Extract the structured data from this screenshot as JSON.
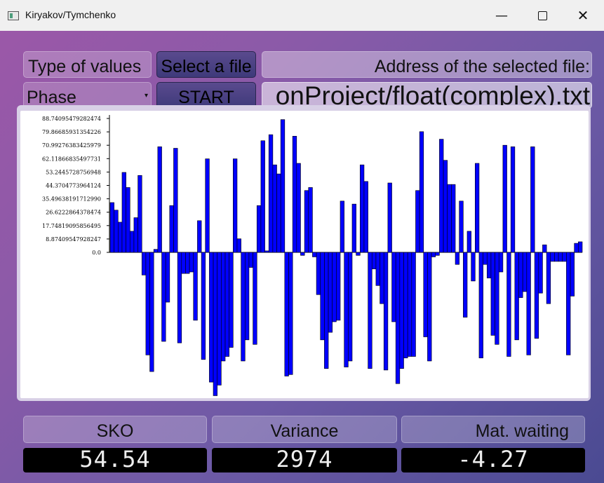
{
  "window": {
    "title": "Kiryakov/Tymchenko",
    "controls": {
      "minimize": "—",
      "close": "✕"
    }
  },
  "controls": {
    "type_of_values_label": "Type of values",
    "select_file_button": "Select a file",
    "address_label": "Address of the selected file:",
    "type_select_value": "Phase",
    "start_button": "START",
    "file_path_value": "onProject/float(complex).txt"
  },
  "stats": {
    "sko_label": "SKO",
    "variance_label": "Variance",
    "mat_waiting_label": "Mat. waiting",
    "sko_value": "54.54",
    "variance_value": "2974",
    "mat_waiting_value": "-4.27"
  },
  "colors": {
    "bar_fill": "#0000ff",
    "bar_stroke": "#000000"
  },
  "chart_data": {
    "type": "bar",
    "y_ticks": [
      "88.74095479282474",
      "79.86685931354226",
      "70.99276383425979",
      "62.11866835497731",
      "53.2445728756948",
      "44.3704773964124",
      "35.49638191712990",
      "26.6222864378474",
      "17.74819095856495",
      "8.87409547928247",
      "0.0"
    ],
    "ylim": [
      -88.74,
      88.74
    ],
    "values": [
      33,
      28,
      20,
      53,
      43,
      14,
      23,
      51,
      -15,
      -68,
      -79,
      2,
      70,
      -59,
      -33,
      31,
      69,
      -60,
      -14,
      -14,
      -13,
      -45,
      21,
      -71,
      62,
      -86,
      -95,
      -88,
      -72,
      -69,
      -63,
      62,
      9,
      -72,
      -58,
      -10,
      -61,
      31,
      74,
      1,
      78,
      58,
      52,
      88,
      -82,
      -81,
      77,
      59,
      -2,
      41,
      43,
      -3,
      -28,
      -58,
      -77,
      -53,
      -46,
      -45,
      34,
      -76,
      -72,
      32,
      -2,
      58,
      47,
      -77,
      -11,
      -22,
      -34,
      -78,
      46,
      -46,
      -87,
      -77,
      -70,
      -69,
      -69,
      41,
      80,
      -56,
      -72,
      -3,
      -2,
      75,
      61,
      45,
      45,
      -8,
      34,
      -43,
      14,
      -19,
      59,
      -70,
      -8,
      -17,
      -55,
      -61,
      -13,
      71,
      -69,
      70,
      -58,
      -30,
      -26,
      -68,
      70,
      -57,
      -27,
      5,
      -34,
      -6,
      -6,
      -6,
      -6,
      -68,
      -29,
      6,
      7
    ]
  }
}
